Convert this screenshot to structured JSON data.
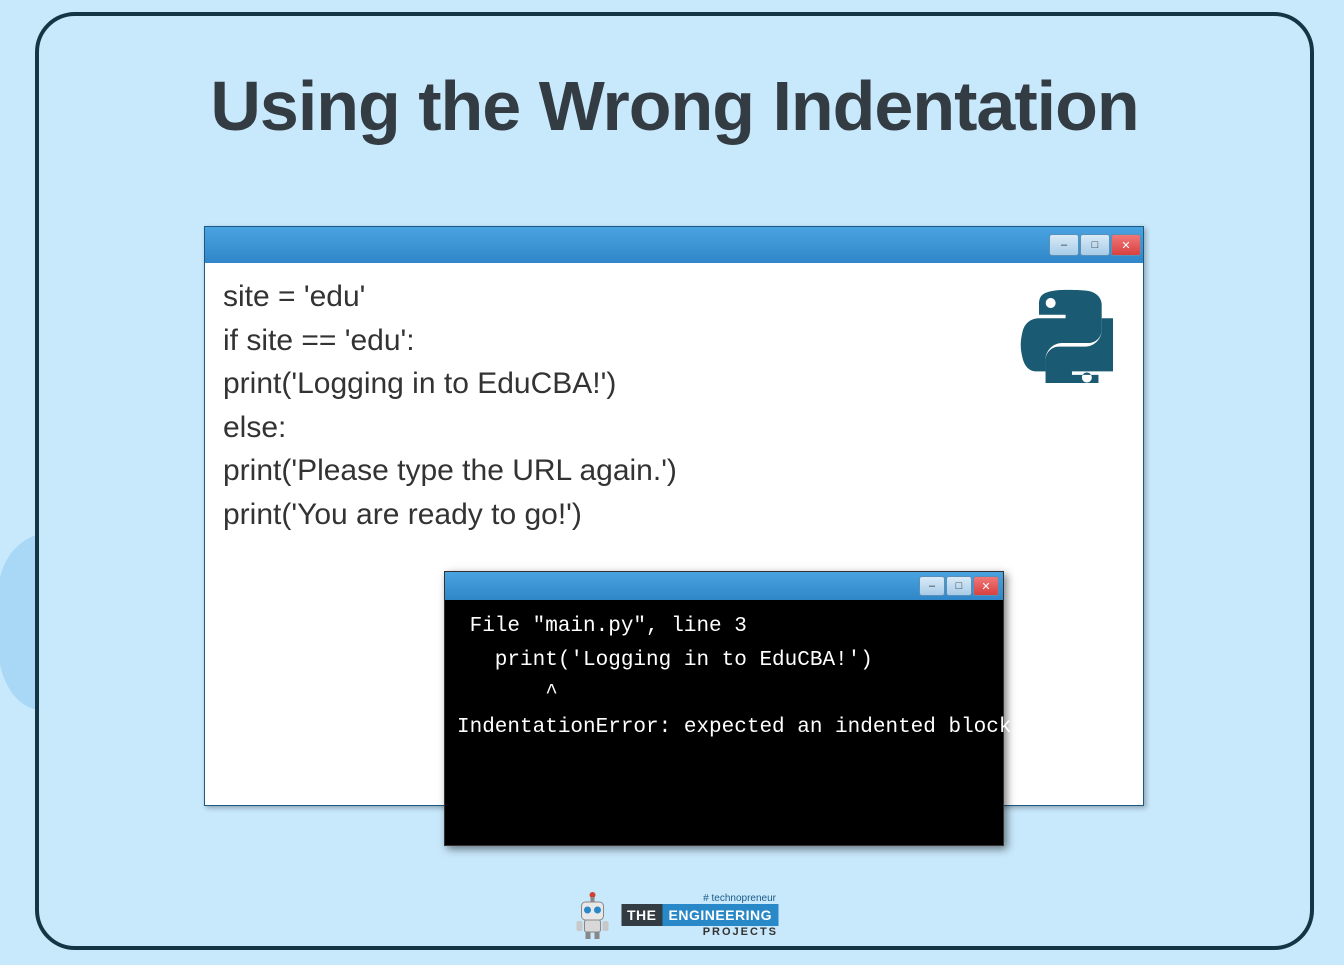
{
  "title": "Using the Wrong Indentation",
  "code_window": {
    "lines": [
      "site = 'edu'",
      "if site == 'edu':",
      "print('Logging in to EduCBA!')",
      "else:",
      "print('Please type the URL again.')",
      "print('You are ready to go!')"
    ]
  },
  "console_window": {
    "content": " File \"main.py\", line 3\n   print('Logging in to EduCBA!')\n       ^\nIndentationError: expected an indented block"
  },
  "python_icon": "python-logo",
  "footer": {
    "hashtag": "# technopreneur",
    "the": "THE",
    "engineering": "ENGINEERING",
    "projects": "PROJECTS"
  },
  "window_controls": {
    "minimize": "–",
    "maximize": "□",
    "close": "✕"
  }
}
